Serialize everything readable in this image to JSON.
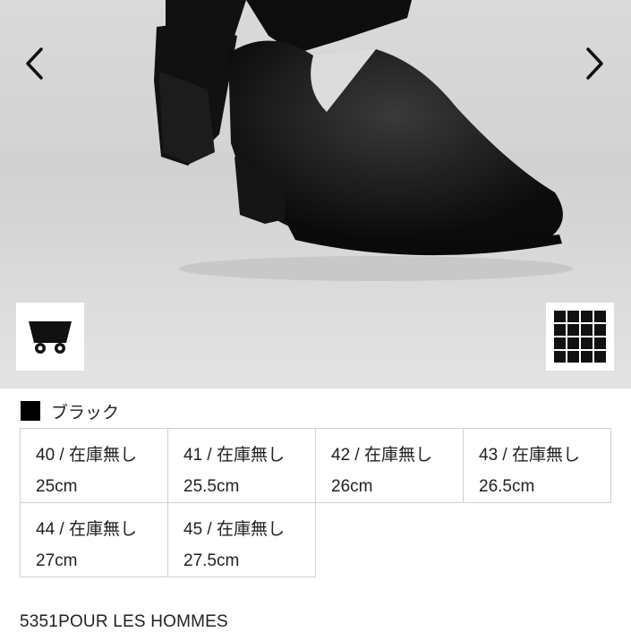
{
  "gallery": {
    "image_alt": "black leather ankle shoe",
    "prev_icon": "chevron-left-icon",
    "next_icon": "chevron-right-icon",
    "cart_icon": "cart-icon",
    "grid_icon": "grid-icon"
  },
  "color": {
    "swatch_color": "#000000",
    "label": "ブラック"
  },
  "sizes": [
    {
      "size": "40 / 在庫無し",
      "cm": "25cm"
    },
    {
      "size": "41 / 在庫無し",
      "cm": "25.5cm"
    },
    {
      "size": "42 / 在庫無し",
      "cm": "26cm"
    },
    {
      "size": "43 / 在庫無し",
      "cm": "26.5cm"
    },
    {
      "size": "44 / 在庫無し",
      "cm": "27cm"
    },
    {
      "size": "45 / 在庫無し",
      "cm": "27.5cm"
    }
  ],
  "brand": "5351POUR LES HOMMES"
}
